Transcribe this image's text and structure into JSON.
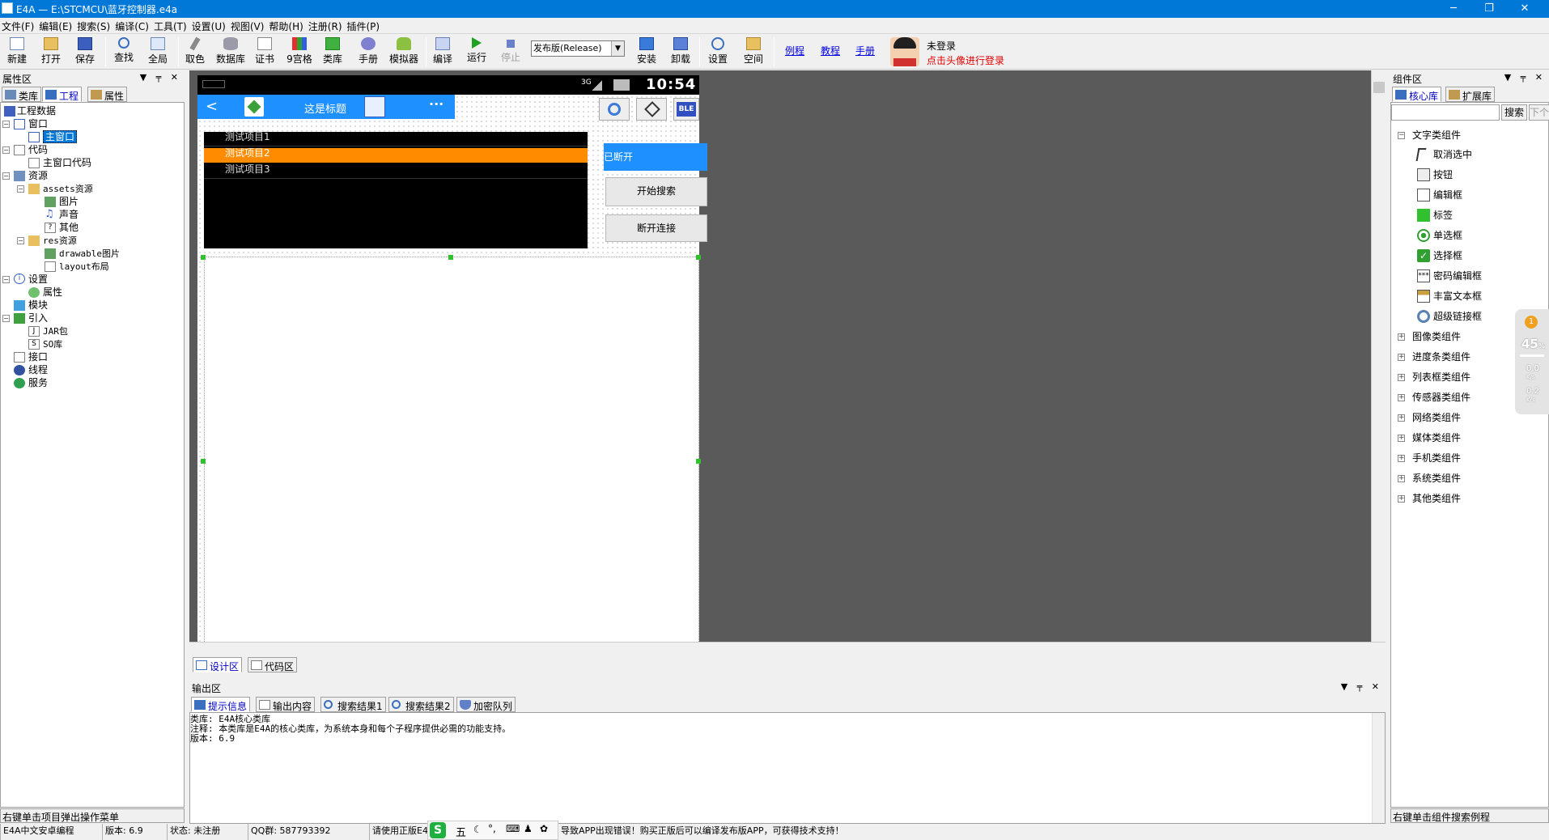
{
  "window": {
    "title": "E4A — E:\\STCMCU\\蓝牙控制器.e4a",
    "min": "─",
    "max": "❐",
    "close": "✕"
  },
  "menu": [
    "文件(F)",
    "编辑(E)",
    "搜索(S)",
    "编译(C)",
    "工具(T)",
    "设置(U)",
    "视图(V)",
    "帮助(H)",
    "注册(R)",
    "插件(P)"
  ],
  "toolbar": {
    "new": "新建",
    "open": "打开",
    "save": "保存",
    "find": "查找",
    "global": "全局",
    "pick_color": "取色",
    "database": "数据库",
    "cert": "证书",
    "grid9": "9宫格",
    "library": "类库",
    "manual": "手册",
    "emulator": "模拟器",
    "compile": "编译",
    "run": "运行",
    "stop": "停止",
    "build_mode": "发布版(Release)",
    "install": "安装",
    "uninstall": "卸载",
    "settings": "设置",
    "space": "空间",
    "link_examples": "例程",
    "link_tutorial": "教程",
    "link_manual": "手册",
    "login_status": "未登录",
    "login_hint": "点击头像进行登录"
  },
  "left_panel": {
    "title": "属性区",
    "tabs": [
      "类库",
      "工程",
      "属性"
    ],
    "tree": [
      "工程数据",
      "窗口",
      "主窗口",
      "代码",
      "主窗口代码",
      "资源",
      "assets资源",
      "图片",
      "声音",
      "其他",
      "res资源",
      "drawable图片",
      "layout布局",
      "设置",
      "属性",
      "模块",
      "引入",
      "JAR包",
      "SO库",
      "接口",
      "线程",
      "服务"
    ],
    "hint": "右键单击项目弹出操作菜单"
  },
  "designer": {
    "status_time": "10:54",
    "status_net": "3G",
    "nav_back": "<",
    "nav_title": "这是标题",
    "nav_more": "···",
    "ble_label": "BLE",
    "list_items": [
      "测试项目1",
      "测试项目2",
      "测试项目3"
    ],
    "disconnected_label": "已断开",
    "btn_search": "开始搜索",
    "btn_disconnect": "断开连接",
    "tabs": [
      "设计区",
      "代码区"
    ]
  },
  "output": {
    "title": "输出区",
    "tabs": [
      "提示信息",
      "输出内容",
      "搜索结果1",
      "搜索结果2",
      "加密队列"
    ],
    "lines": [
      "类库: E4A核心类库",
      "注释: 本类库是E4A的核心类库，为系统本身和每个子程序提供必需的功能支持。",
      "版本: 6.9"
    ]
  },
  "right_panel": {
    "title": "组件区",
    "tabs": [
      "核心库",
      "扩展库"
    ],
    "search_btn": "搜索",
    "next_btn": "下个",
    "groups_open": "文字类组件",
    "text_components": [
      "取消选中",
      "按钮",
      "编辑框",
      "标签",
      "单选框",
      "选择框",
      "密码编辑框",
      "丰富文本框",
      "超级链接框"
    ],
    "groups": [
      "图像类组件",
      "进度条类组件",
      "列表框类组件",
      "传感器类组件",
      "网络类组件",
      "媒体类组件",
      "手机类组件",
      "系统类组件",
      "其他类组件"
    ],
    "hint": "右键单击组件搜索例程"
  },
  "floating_widget": {
    "badge": "1",
    "percent": "45",
    "pct_sign": "%",
    "up": "0.0",
    "down": "0.2",
    "unit": "K/s"
  },
  "statusbar": {
    "s1": "E4A中文安卓编程",
    "s2": "版本: 6.9",
    "s3": "状态: 未注册",
    "s4": "QQ群: 587793392",
    "s5": "请使用正版E4",
    "s6": "导致APP出现错误！购买正版后可以编译发布版APP，可获得技术支持！",
    "ime": "五"
  },
  "colors": {
    "accent": "#0078d7",
    "phone_blue": "#1e90ff",
    "list_selected": "#ff8c00",
    "dark_gray": "#5a5a5a"
  }
}
